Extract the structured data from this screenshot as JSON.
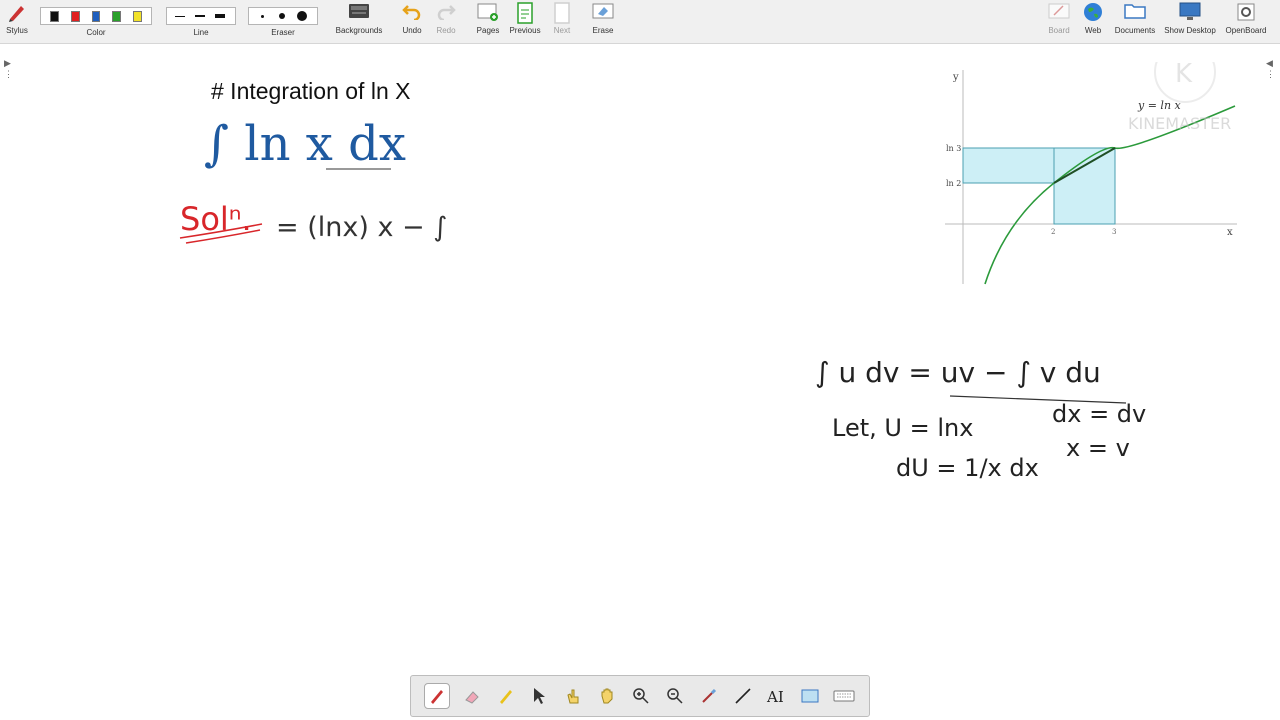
{
  "toolbar": {
    "stylus": "Stylus",
    "color": "Color",
    "line": "Line",
    "eraser": "Eraser",
    "backgrounds": "Backgrounds",
    "undo": "Undo",
    "redo": "Redo",
    "pages": "Pages",
    "previous": "Previous",
    "next": "Next",
    "erase": "Erase",
    "board": "Board",
    "web": "Web",
    "documents": "Documents",
    "show_desktop": "Show Desktop",
    "openboard": "OpenBoard",
    "colors": [
      "#111111",
      "#e02020",
      "#1f5fbf",
      "#2aa02a",
      "#f2e22a"
    ]
  },
  "canvas": {
    "heading": "# Integration of ln X",
    "integral": "∫ ln x dx",
    "soln": "Solⁿ.",
    "step1": "= (lnx) x − ∫",
    "formula": "∫ u dv = uv − ∫ v du",
    "let_line": "Let, U = lnx",
    "dx_line": "dx = dv",
    "du_line": "dU = 1/x dx",
    "xv_line": "x = v"
  },
  "graph": {
    "y_axis": "y",
    "x_axis": "x",
    "curve_label": "y = ln x",
    "ln3": "ln 3",
    "ln2": "ln 2",
    "tick2": "2",
    "tick3": "3",
    "watermark": "KINEMASTER",
    "watermark_logo": "K"
  }
}
